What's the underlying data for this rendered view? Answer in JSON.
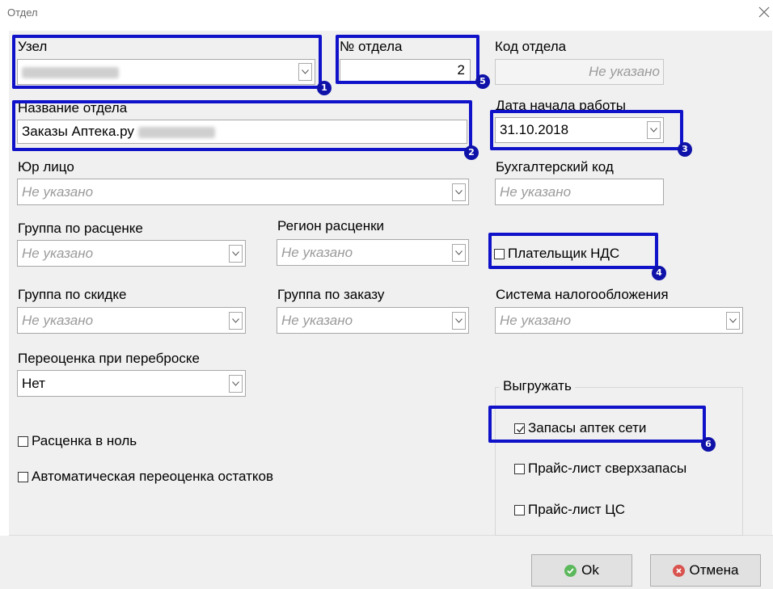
{
  "window": {
    "title": "Отдел"
  },
  "fields": {
    "node": {
      "label": "Узел"
    },
    "dept_number": {
      "label": "№ отдела",
      "value": "2"
    },
    "dept_code": {
      "label": "Код отдела",
      "placeholder": "Не указано"
    },
    "dept_name": {
      "label": "Название отдела",
      "value": "Заказы Аптека.ру"
    },
    "start_date": {
      "label": "Дата начала работы",
      "value": "31.10.2018"
    },
    "legal_entity": {
      "label": "Юр лицо",
      "placeholder": "Не указано"
    },
    "accounting_code": {
      "label": "Бухгалтерский код",
      "placeholder": "Не указано"
    },
    "pricing_group": {
      "label": "Группа по расценке",
      "placeholder": "Не указано"
    },
    "pricing_region": {
      "label": "Регион расценки",
      "placeholder": "Не указано"
    },
    "discount_group": {
      "label": "Группа по скидке",
      "placeholder": "Не указано"
    },
    "order_group": {
      "label": "Группа по заказу",
      "placeholder": "Не указано"
    },
    "tax_system": {
      "label": "Система налогообложения",
      "placeholder": "Не указано"
    },
    "revaluation": {
      "label": "Переоценка при переброске",
      "value": "Нет"
    }
  },
  "checkboxes": {
    "vat_payer": {
      "label": "Плательщик НДС",
      "checked": false
    },
    "zero_pricing": {
      "label": "Расценка в ноль",
      "checked": false
    },
    "auto_revaluation": {
      "label": "Автоматическая переоценка остатков",
      "checked": false
    }
  },
  "export": {
    "legend": "Выгружать",
    "items": [
      {
        "label": "Запасы аптек сети",
        "checked": true
      },
      {
        "label": "Прайс-лист сверхзапасы",
        "checked": false
      },
      {
        "label": "Прайс-лист ЦС",
        "checked": false
      }
    ]
  },
  "badges": [
    "1",
    "2",
    "3",
    "4",
    "5",
    "6"
  ],
  "buttons": {
    "ok": "Ok",
    "cancel": "Отмена"
  },
  "colors": {
    "highlight": "#0f12c8",
    "badge": "#0f12a8",
    "ok_icon": "#5cb85c",
    "cancel_icon": "#d9534f"
  },
  "icons": {
    "close": "close-icon",
    "dropdown": "chevron-down-icon",
    "ok": "check-circle-icon",
    "cancel": "x-circle-icon"
  }
}
